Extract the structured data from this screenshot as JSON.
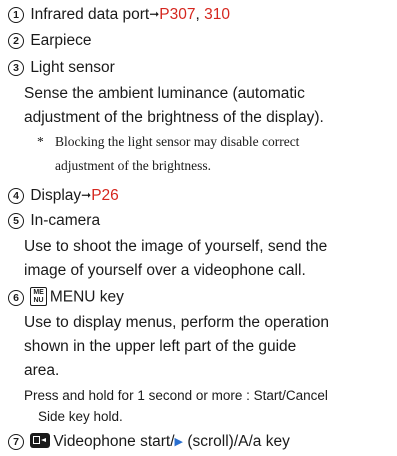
{
  "items": [
    {
      "num": "1",
      "label": "Infrared data port",
      "arrow": "➞",
      "ref1": "P307",
      "sep": ", ",
      "ref2": "310"
    },
    {
      "num": "2",
      "label": "Earpiece"
    },
    {
      "num": "3",
      "label": "Light sensor",
      "desc": [
        "Sense the ambient luminance (automatic",
        "adjustment of the brightness of the display)."
      ],
      "note_mark": "*",
      "note": [
        "Blocking the light sensor may disable correct",
        "adjustment of the brightness."
      ]
    },
    {
      "num": "4",
      "label": "Display",
      "arrow": "➞",
      "ref1": "P26"
    },
    {
      "num": "5",
      "label": "In-camera",
      "desc": [
        "Use to shoot the image of yourself, send the",
        "image of yourself over a videophone call."
      ]
    },
    {
      "num": "6",
      "key_top": "ME",
      "key_bottom": "NU",
      "label": "MENU key",
      "desc": [
        "Use to display menus, perform the operation",
        "shown in the upper left part of the guide",
        "area."
      ],
      "hold": [
        "Press and hold for 1 second or more : Start/Cancel",
        "Side key hold."
      ]
    },
    {
      "num": "7",
      "label_a": "Videophone start/",
      "tri": "▶",
      "label_b": " (scroll)/A/a key"
    }
  ]
}
